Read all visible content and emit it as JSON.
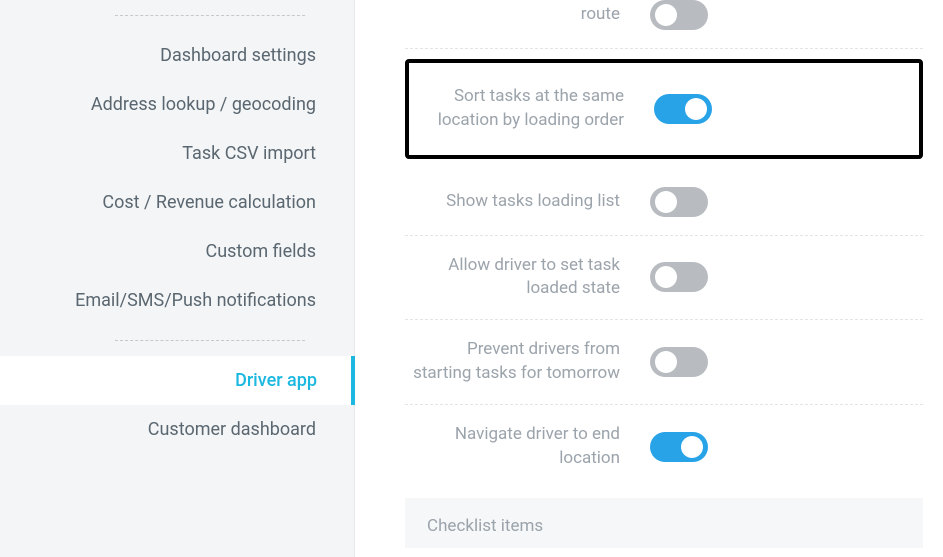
{
  "sidebar": {
    "items": [
      {
        "label": "Dashboard settings"
      },
      {
        "label": "Address lookup / geocoding"
      },
      {
        "label": "Task CSV import"
      },
      {
        "label": "Cost / Revenue calculation"
      },
      {
        "label": "Custom fields"
      },
      {
        "label": "Email/SMS/Push notifications"
      },
      {
        "label": "Driver app"
      },
      {
        "label": "Customer dashboard"
      }
    ]
  },
  "settings": {
    "reorder_route": {
      "label": "route",
      "on": false
    },
    "sort_tasks_loading_order": {
      "label": "Sort tasks at the same location by loading order",
      "on": true
    },
    "show_loading_list": {
      "label": "Show tasks loading list",
      "on": false
    },
    "allow_set_loaded_state": {
      "label": "Allow driver to set task loaded state",
      "on": false
    },
    "prevent_tomorrow": {
      "label": "Prevent drivers from starting tasks for tomorrow",
      "on": false
    },
    "navigate_end": {
      "label": "Navigate driver to end location",
      "on": true
    }
  },
  "section": {
    "checklist": "Checklist items"
  }
}
